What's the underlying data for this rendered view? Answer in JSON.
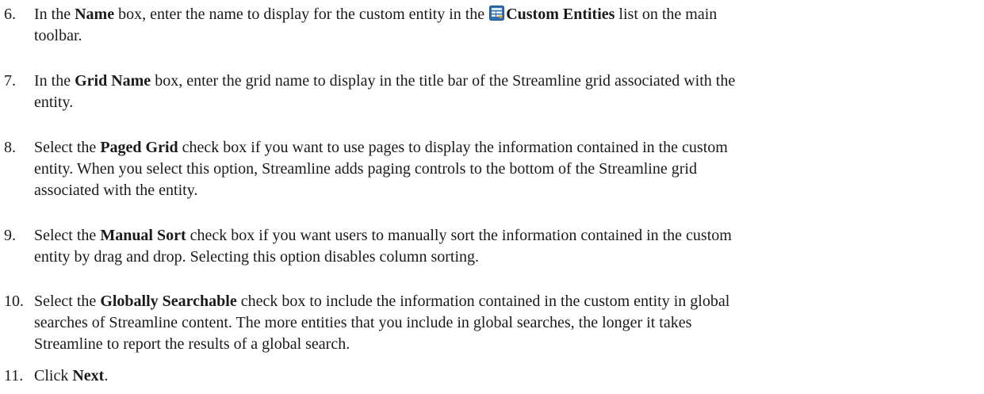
{
  "steps": [
    {
      "number": "6.",
      "t1": "In the ",
      "b1": "Name",
      "t2": " box, enter the name to display for the custom entity in the ",
      "icon": "custom-entities-icon",
      "b2": "Custom Entities",
      "t3": " list on the main",
      "line2": "toolbar."
    },
    {
      "number": "7.",
      "t1": "In the ",
      "b1": "Grid Name",
      "t2": " box, enter the grid name to display in the title bar of the Streamline grid associated with the",
      "line2": "entity."
    },
    {
      "number": "8.",
      "t1": "Select the ",
      "b1": "Paged Grid",
      "t2": " check box if you want to use pages to display the information contained in the custom",
      "line2": "entity. When you select this option, Streamline adds paging controls to the bottom of the Streamline grid",
      "line3": "associated with the entity."
    },
    {
      "number": "9.",
      "t1": "Select the ",
      "b1": "Manual Sort",
      "t2": " check box if you want users to manually sort the information contained in the custom",
      "line2": "entity by drag and drop. Selecting this option disables column sorting."
    },
    {
      "number": "10.",
      "t1": "Select the ",
      "b1": "Globally Searchable",
      "t2": " check box to include the information contained in the custom entity in global",
      "line2": "searches of Streamline content. The more entities that you include in global searches, the longer it takes",
      "line3": "Streamline to report the results of a global search."
    },
    {
      "number": "11.",
      "t1": "Click ",
      "b1": "Next",
      "t2": "."
    }
  ]
}
